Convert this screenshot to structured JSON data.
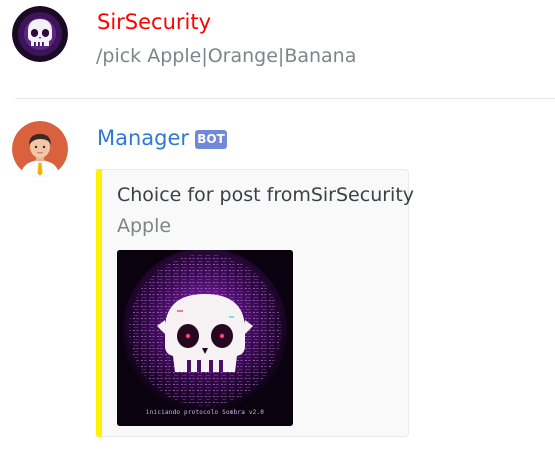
{
  "messages": [
    {
      "username": "SirSecurity",
      "username_color": "#ff0000",
      "text": "/pick Apple|Orange|Banana",
      "avatar_icon": "skull-avatar-icon"
    },
    {
      "username": "Manager",
      "username_color": "#2e7ad1",
      "badge": "BOT",
      "avatar_icon": "manager-avatar-icon",
      "embed": {
        "accent_color": "#fff200",
        "title": "Choice for post fromSirSecurity",
        "description": "Apple",
        "image_icon": "sombra-skull-image",
        "image_caption": "iniciando protocolo Sombra v2.0"
      }
    }
  ]
}
